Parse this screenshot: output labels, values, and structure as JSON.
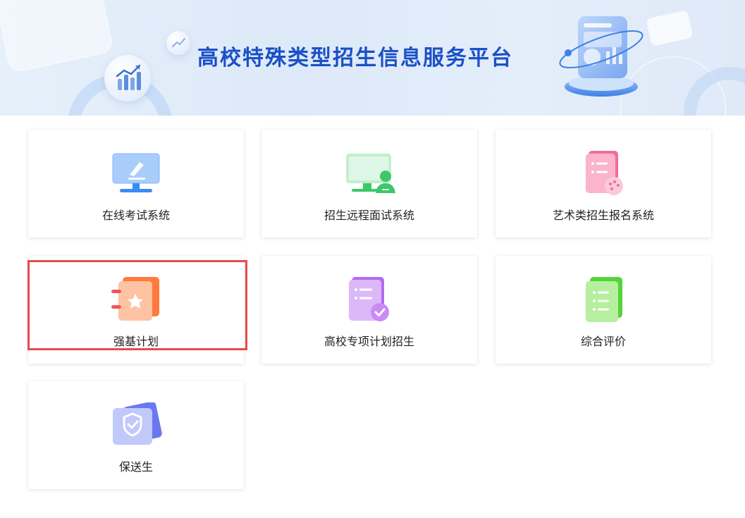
{
  "banner": {
    "title": "高校特殊类型招生信息服务平台"
  },
  "cards": [
    {
      "label": "在线考试系统",
      "icon": "monitor-pen-icon"
    },
    {
      "label": "招生远程面试系统",
      "icon": "remote-interview-icon"
    },
    {
      "label": "艺术类招生报名系统",
      "icon": "art-registration-icon"
    },
    {
      "label": "强基计划",
      "icon": "star-notebook-icon"
    },
    {
      "label": "高校专项计划招生",
      "icon": "checklist-document-icon"
    },
    {
      "label": "综合评价",
      "icon": "list-document-icon"
    },
    {
      "label": "保送生",
      "icon": "shield-check-icon"
    }
  ],
  "colors": {
    "title_blue": "#1a50c8",
    "highlight_red": "#e84b4b",
    "online_exam_blue": "#3a8cf2",
    "interview_green": "#3cc86a",
    "art_pink": "#f56b9a",
    "strong_base_orange": "#ff7a3c",
    "special_plan_purple": "#b36af0",
    "comprehensive_green": "#54d43a",
    "recommended_indigo": "#6a78f0"
  }
}
